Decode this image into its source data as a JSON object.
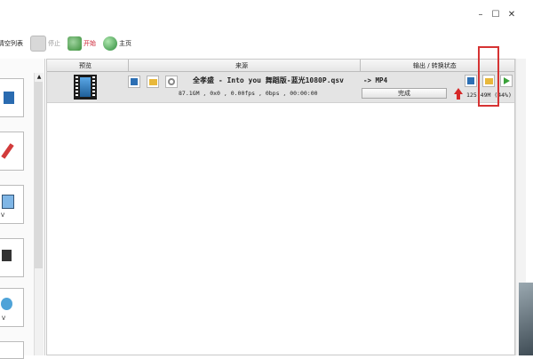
{
  "window": {
    "minimize": "–",
    "maximize": "☐",
    "close": "✕"
  },
  "toolbar": {
    "clear_list": "清空列表",
    "stop": "停止",
    "start": "开始",
    "home": "主页"
  },
  "table": {
    "headers": {
      "preview": "预览",
      "source": "来源",
      "output": "输出 / 转换状态"
    },
    "row": {
      "filename": "全孝盛 - Into you 舞蹈版-蓝光1080P.qsv",
      "info": "87.1GM , 0x0 , 0.00fps , 0bps , 00:00:00",
      "output_format": "-> MP4",
      "status": "完成",
      "output_size": "125.49M  (44%)"
    }
  },
  "sidebar": {
    "labels": [
      "V",
      "V"
    ]
  },
  "colors": {
    "highlight": "#d63333",
    "row_bg": "#e4e4e4"
  }
}
